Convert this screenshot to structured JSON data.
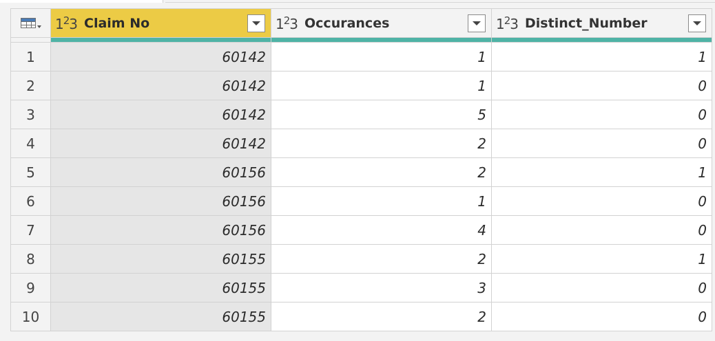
{
  "table": {
    "columns": [
      {
        "label": "Claim No",
        "type_icon": "123-icon",
        "selected": true
      },
      {
        "label": "Occurances",
        "type_icon": "123-icon",
        "selected": false
      },
      {
        "label": "Distinct_Number",
        "type_icon": "123-icon",
        "selected": false
      }
    ],
    "type_icon_text": {
      "a": "1",
      "b": "2",
      "c": "3"
    },
    "rows": [
      {
        "index": "1",
        "claim_no": "60142",
        "occurances": "1",
        "distinct_number": "1"
      },
      {
        "index": "2",
        "claim_no": "60142",
        "occurances": "1",
        "distinct_number": "0"
      },
      {
        "index": "3",
        "claim_no": "60142",
        "occurances": "5",
        "distinct_number": "0"
      },
      {
        "index": "4",
        "claim_no": "60142",
        "occurances": "2",
        "distinct_number": "0"
      },
      {
        "index": "5",
        "claim_no": "60156",
        "occurances": "2",
        "distinct_number": "1"
      },
      {
        "index": "6",
        "claim_no": "60156",
        "occurances": "1",
        "distinct_number": "0"
      },
      {
        "index": "7",
        "claim_no": "60156",
        "occurances": "4",
        "distinct_number": "0"
      },
      {
        "index": "8",
        "claim_no": "60155",
        "occurances": "2",
        "distinct_number": "1"
      },
      {
        "index": "9",
        "claim_no": "60155",
        "occurances": "3",
        "distinct_number": "0"
      },
      {
        "index": "10",
        "claim_no": "60155",
        "occurances": "2",
        "distinct_number": "0"
      }
    ]
  },
  "colors": {
    "selected_header": "#eccb45",
    "quality_bar": "#4fb3a6",
    "selected_column": "#e6e6e6"
  }
}
